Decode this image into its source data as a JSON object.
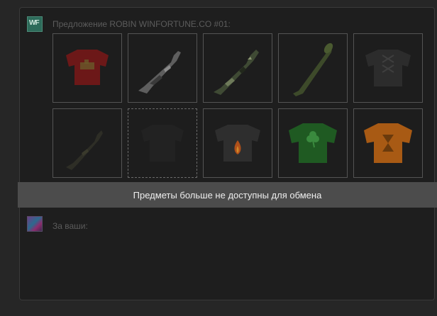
{
  "offer": {
    "heading": "Предложение ROBIN WINFORTUNE.CO #01:",
    "avatar_mark": "WF",
    "items": [
      {
        "name": "item-red-tshirt-icon",
        "kind": "red-shirt"
      },
      {
        "name": "item-gray-camo-rifle-icon",
        "kind": "gray-rifle"
      },
      {
        "name": "item-camo-rifle-icon",
        "kind": "camo-rifle"
      },
      {
        "name": "item-green-launcher-icon",
        "kind": "launcher"
      },
      {
        "name": "item-dark-laced-shirt-icon",
        "kind": "dark-laced"
      },
      {
        "name": "item-dark-rifle-icon",
        "kind": "dark-rifle"
      },
      {
        "name": "item-empty-slot",
        "kind": "empty"
      },
      {
        "name": "item-flame-tshirt-icon",
        "kind": "flame-shirt"
      },
      {
        "name": "item-clover-tshirt-icon",
        "kind": "clover-shirt"
      },
      {
        "name": "item-orange-hourglass-shirt-icon",
        "kind": "orange-shirt"
      }
    ]
  },
  "notice": "Предметы больше не доступны для обмена",
  "yours": {
    "heading": "За ваши:"
  }
}
